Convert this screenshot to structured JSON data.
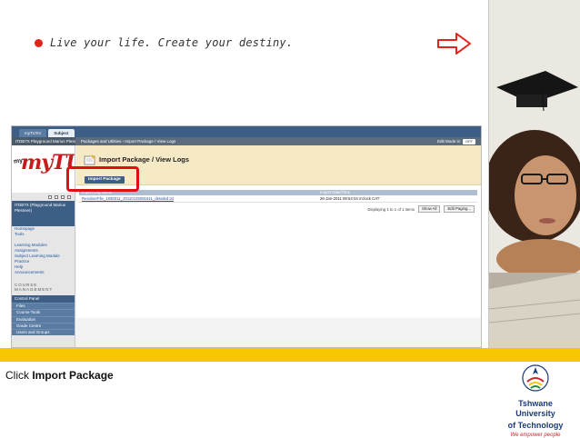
{
  "slide": {
    "tagline": "Live your life. Create your destiny.",
    "caption_prefix": "Click ",
    "caption_bold": "Import Package",
    "logo_line1": "Tshwane University",
    "logo_line2": "of Technology",
    "logo_tagline": "We empower people",
    "colors": {
      "accent_red": "#e1251b",
      "bar_yellow": "#f7c600",
      "lms_blue": "#3d5f86"
    }
  },
  "lms": {
    "tabs": [
      "myTUTor",
      "Subject"
    ],
    "active_tab": 1,
    "course_nav_title": "ITDB7X Playground Marius Plessner",
    "breadcrumb": "Packages and Utilities  ›  Import Package / View Logs",
    "edit_mode_label": "Edit Mode is:",
    "edit_mode_value": "OFF",
    "logo_text": "myTUTor",
    "logo_sub": "my",
    "course_box": "ITDB7X (Playground Marius Plessner)",
    "course_links": [
      "Homepage",
      "Tools"
    ],
    "content_links": [
      "Learning Modules",
      "Assignments",
      "Subject Learning Module",
      "Practice",
      "Help",
      "Announcements"
    ],
    "course_management_label": "COURSE MANAGEMENT",
    "control_panel_label": "Control Panel",
    "control_panel_items": [
      "Files",
      "Course Tools",
      "Evaluation",
      "Grade Centre",
      "Users and Groups"
    ],
    "page_title": "Import Package / View Logs",
    "import_button": "Import Package",
    "table_headers": [
      "Import Log Name",
      "Import Date/Time"
    ],
    "rows": [
      {
        "name": "ResolverFile_1836011_20110126091611_detailed.txt",
        "date": "26-Jan-2011 08:54:04 o'clock CAT"
      }
    ],
    "paging_text": "Displaying 1 to 1 of 1 items",
    "show_all": "Show All",
    "edit_paging": "Edit Paging..."
  }
}
